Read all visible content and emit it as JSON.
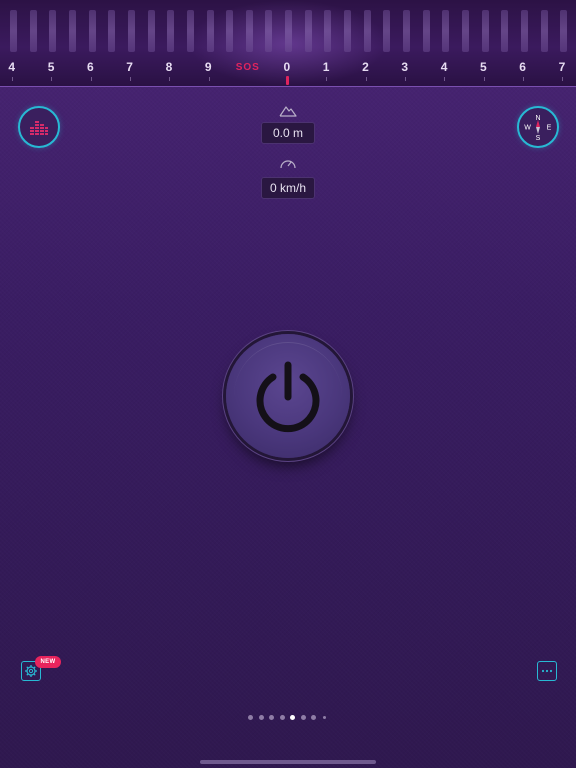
{
  "strobe_dial": {
    "labels": [
      "4",
      "5",
      "6",
      "7",
      "8",
      "9",
      "SOS",
      "0",
      "1",
      "2",
      "3",
      "4",
      "5",
      "6",
      "7"
    ],
    "selected": "0",
    "indicator_color": "#e0245e"
  },
  "altitude": {
    "icon": "mountain-icon",
    "value": "0.0 m"
  },
  "speed": {
    "icon": "speedometer-icon",
    "value": "0 km/h"
  },
  "equalizer_button": {
    "icon": "equalizer-icon"
  },
  "compass": {
    "icon": "compass-icon",
    "north": "N",
    "south": "S",
    "east": "E",
    "west": "W"
  },
  "power_button": {
    "icon": "power-icon"
  },
  "settings_button": {
    "icon": "gear-icon",
    "badge": "NEW"
  },
  "more_button": {
    "icon": "more-dots-icon"
  },
  "pagination": {
    "total": 8,
    "active_index": 4
  },
  "colors": {
    "accent": "#28b9d4",
    "badge": "#e8245d",
    "background": "#3a1d63"
  }
}
